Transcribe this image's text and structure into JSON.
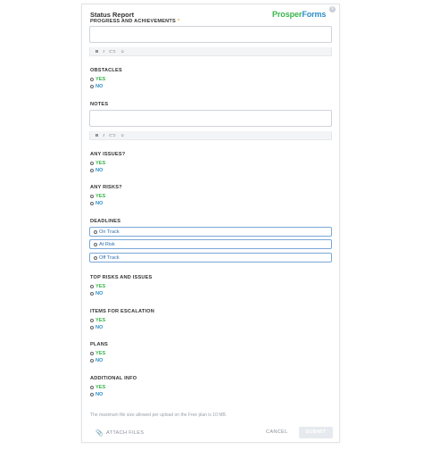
{
  "form": {
    "title": "Status Report",
    "logo": {
      "part1": "Prosper",
      "part2": "Forms"
    },
    "close_glyph": "x",
    "required_mark": "*"
  },
  "fields": {
    "progress": {
      "label": "PROGRESS AND ACHIEVEMENTS"
    },
    "obstacles": {
      "label": "OBSTACLES",
      "yes": "YES",
      "no": "NO"
    },
    "notes": {
      "label": "NOTES"
    },
    "issues": {
      "label": "ANY ISSUES?",
      "yes": "YES",
      "no": "NO"
    },
    "risks": {
      "label": "ANY RISKS?",
      "yes": "YES",
      "no": "NO"
    },
    "deadlines": {
      "label": "DEADLINES",
      "options": [
        "On Track",
        "At Risk",
        "Off Track"
      ]
    },
    "top_risks": {
      "label": "TOP RISKS AND ISSUES",
      "yes": "YES",
      "no": "NO"
    },
    "escalation": {
      "label": "ITEMS FOR ESCALATION",
      "yes": "YES",
      "no": "NO"
    },
    "plans": {
      "label": "PLANS",
      "yes": "YES",
      "no": "NO"
    },
    "additional": {
      "label": "ADDITIONAL INFO",
      "yes": "YES",
      "no": "NO"
    }
  },
  "toolbar": {
    "bold": "B",
    "italic": "I",
    "link": "⊂⊃",
    "emoji": "☺"
  },
  "footer": {
    "note": "The maximum file size allowed per upload on the Free plan is 10 MB.",
    "attach": "ATTACH FILES",
    "cancel": "CANCEL",
    "submit": "SUBMIT"
  },
  "colors": {
    "yes": "#39b54a",
    "no": "#2e8fc8",
    "required": "#f5a623"
  }
}
